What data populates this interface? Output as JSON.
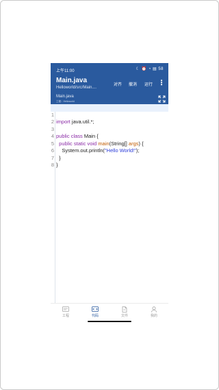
{
  "status": {
    "time": "上午11:00",
    "icons": "☾ ⏰ ◔ ▤ 58"
  },
  "header": {
    "title": "Main.java",
    "subtitle": "Helloworld/src/Main....",
    "actions": {
      "align": "对齐",
      "undo": "撤消",
      "run": "运行"
    },
    "more_icon": "more-vertical-icon",
    "fullscreen_icon": "fullscreen-icon"
  },
  "tab": {
    "file": "Main.java",
    "path": "工程：Helloworld"
  },
  "code": {
    "lines": [
      {
        "n": "1",
        "highlighted": true
      },
      {
        "n": "2"
      },
      {
        "n": "3"
      },
      {
        "n": "4"
      },
      {
        "n": "5"
      },
      {
        "n": "6"
      },
      {
        "n": "7"
      },
      {
        "n": "8"
      }
    ],
    "tokens": {
      "import": "import",
      "java_util": " java.util.*;",
      "public1": "public",
      "class": " class",
      "main_class": " Main {",
      "indent2": "  ",
      "public2": "public",
      "static": " static",
      "void": " void",
      "space": " ",
      "main_fn": "main",
      "args_open": "(String[] ",
      "args": "args",
      "args_close": ") {",
      "indent3": "    ",
      "println": "System.out.println(",
      "hello": "\"Hello World!\"",
      "println_end": ");",
      "close_inner": "  }",
      "close_outer": "}"
    }
  },
  "nav": {
    "items": [
      {
        "label": "工程",
        "icon": "project-icon"
      },
      {
        "label": "代码",
        "icon": "code-icon"
      },
      {
        "label": "文件",
        "icon": "file-icon"
      },
      {
        "label": "我的",
        "icon": "user-icon"
      }
    ],
    "active_color": "#2a5a9e"
  },
  "colors": {
    "header": "#2a5a9e",
    "keyword": "#8a2aa6",
    "function": "#c25c00",
    "string": "#2a3bd9"
  }
}
